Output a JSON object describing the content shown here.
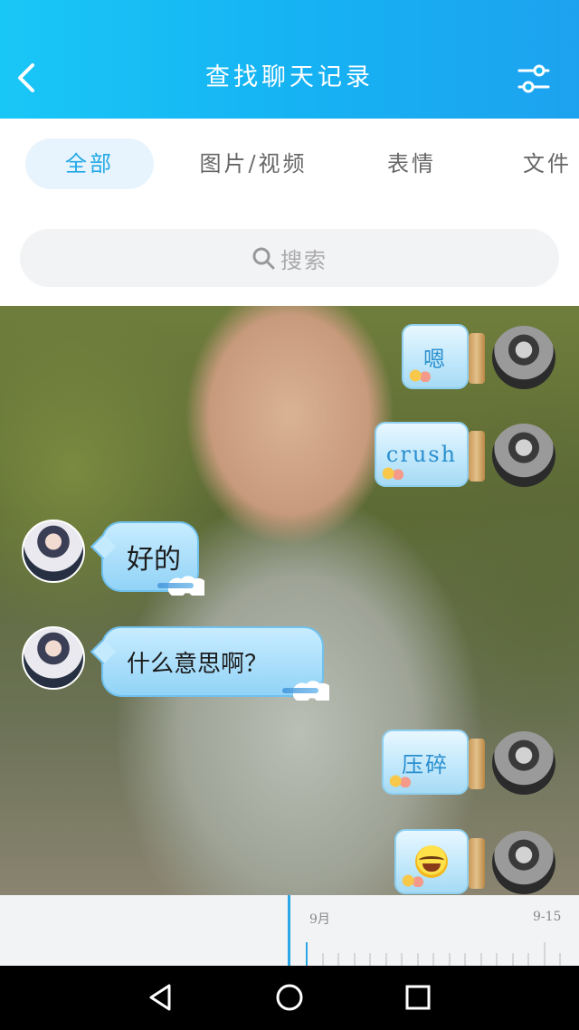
{
  "header": {
    "title": "查找聊天记录"
  },
  "tabs": [
    {
      "label": "全部",
      "active": true
    },
    {
      "label": "图片/视频",
      "active": false
    },
    {
      "label": "表情",
      "active": false
    },
    {
      "label": "文件",
      "active": false
    }
  ],
  "search": {
    "placeholder": "搜索"
  },
  "messages": [
    {
      "side": "sent",
      "text": "嗯"
    },
    {
      "side": "sent",
      "text": "crush"
    },
    {
      "side": "received",
      "text": "好的"
    },
    {
      "side": "received",
      "text": "什么意思啊？"
    },
    {
      "side": "sent",
      "text": "压碎"
    },
    {
      "side": "sent",
      "emoji": "laughing-tears-emoji"
    }
  ],
  "timeline": {
    "month_label": "9月",
    "date_label": "9-15"
  },
  "colors": {
    "header": "#16b3f3",
    "accent": "#23a9e6"
  }
}
